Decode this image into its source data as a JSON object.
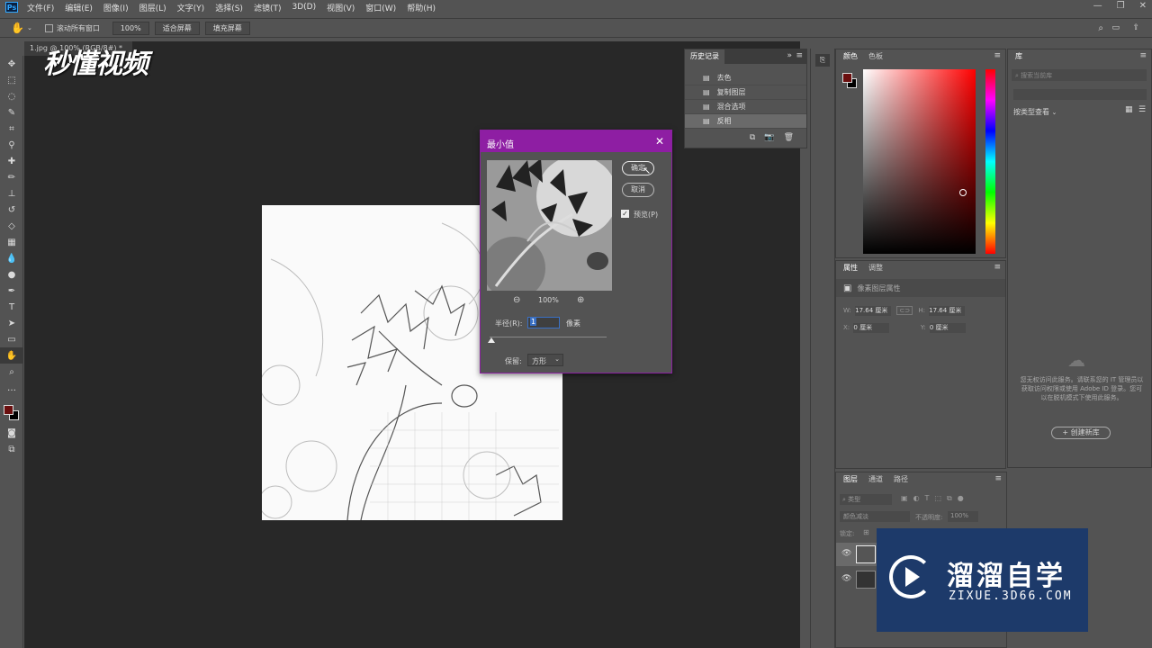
{
  "app": {
    "logo": "Ps"
  },
  "menu": [
    "文件(F)",
    "编辑(E)",
    "图像(I)",
    "图层(L)",
    "文字(Y)",
    "选择(S)",
    "滤镜(T)",
    "3D(D)",
    "视图(V)",
    "窗口(W)",
    "帮助(H)"
  ],
  "options": {
    "scroll_all_label": "滚动所有窗口",
    "zoom_label": "100%",
    "fit_screen_label": "适合屏幕",
    "fill_screen_label": "填充屏幕"
  },
  "document": {
    "tab_title": "1.jpg @ 100% (RGB/8#) *"
  },
  "watermark": {
    "brand": "秒懂视频",
    "site_name": "溜溜自学",
    "site_url": "ZIXUE.3D66.COM"
  },
  "history": {
    "tab_label": "历史记录",
    "items": [
      "去色",
      "复制图层",
      "混合选项",
      "反相"
    ]
  },
  "dialog": {
    "title": "最小值",
    "ok_label": "确定",
    "cancel_label": "取消",
    "preview_label": "预览(P)",
    "zoom_value": "100%",
    "radius_label": "半径(R):",
    "radius_value": "1",
    "unit_label": "像素",
    "preserve_label": "保留:",
    "preserve_value": "方形"
  },
  "color_panel": {
    "tab_color": "颜色",
    "tab_swatches": "色板"
  },
  "properties_panel": {
    "tab_properties": "属性",
    "tab_adjustments": "调整",
    "layer_props_label": "像素图层属性",
    "w_label": "W:",
    "w_value": "17.64 厘米",
    "h_label": "H:",
    "h_value": "17.64 厘米",
    "x_label": "X:",
    "x_value": "0 厘米",
    "y_label": "Y:",
    "y_value": "0 厘米"
  },
  "library_panel": {
    "tab_label": "库",
    "search_placeholder": "搜索当前库",
    "view_label": "按类型查看",
    "message": "您无权访问此服务。请联系您的 IT 管理员以获取访问权限或使用 Adobe ID 登录。您可以在脱机模式下使用此服务。",
    "create_label": "+ 创建新库"
  },
  "layers_panel": {
    "tab_layers": "图层",
    "tab_channels": "通道",
    "tab_paths": "路径",
    "filter_label": "类型",
    "blend_mode": "颜色减淡",
    "opacity_label": "不透明度:",
    "opacity_value": "100%",
    "lock_label": "锁定:"
  },
  "colors": {
    "foreground": "#6b0f0f",
    "dialog_accent": "#8e1ea3",
    "zixue_bg": "#1d3a6a"
  }
}
